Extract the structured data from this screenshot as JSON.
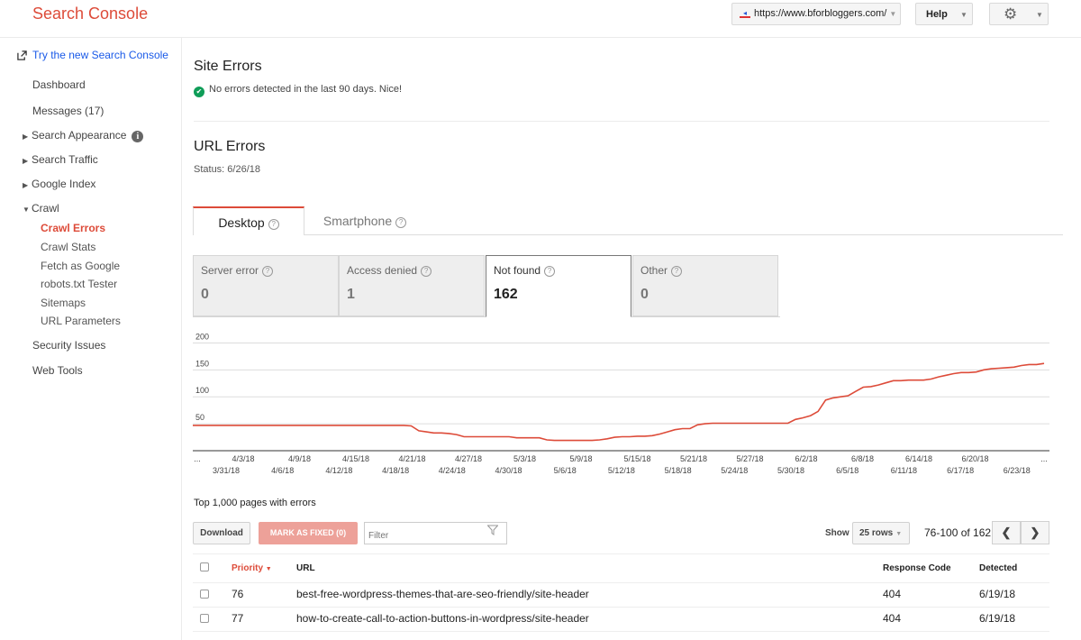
{
  "header": {
    "brand": "Search Console",
    "site": "https://www.bforbloggers.com/",
    "help_label": "Help"
  },
  "sidebar": {
    "try_new": "Try the new Search Console",
    "dashboard": "Dashboard",
    "messages": "Messages (17)",
    "search_appearance": "Search Appearance",
    "search_traffic": "Search Traffic",
    "google_index": "Google Index",
    "crawl": "Crawl",
    "crawl_children": [
      "Crawl Errors",
      "Crawl Stats",
      "Fetch as Google",
      "robots.txt Tester",
      "Sitemaps",
      "URL Parameters"
    ],
    "security_issues": "Security Issues",
    "web_tools": "Web Tools"
  },
  "site_errors": {
    "title": "Site Errors",
    "message": "No errors detected in the last 90 days. Nice!"
  },
  "url_errors": {
    "title": "URL Errors",
    "status": "Status: 6/26/18"
  },
  "tabs": [
    {
      "label": "Desktop",
      "active": true
    },
    {
      "label": "Smartphone",
      "active": false
    }
  ],
  "metrics": [
    {
      "label": "Server error",
      "value": "0"
    },
    {
      "label": "Access denied",
      "value": "1"
    },
    {
      "label": "Not found",
      "value": "162",
      "selected": true
    },
    {
      "label": "Other",
      "value": "0"
    }
  ],
  "chart_data": {
    "type": "line",
    "ylim": [
      0,
      200
    ],
    "yticks": [
      50,
      100,
      150,
      200
    ],
    "x_labels_top": [
      "...",
      "4/3/18",
      "4/9/18",
      "4/15/18",
      "4/21/18",
      "4/27/18",
      "5/3/18",
      "5/9/18",
      "5/15/18",
      "5/21/18",
      "5/27/18",
      "6/2/18",
      "6/8/18",
      "6/14/18",
      "6/20/18",
      "..."
    ],
    "x_labels_bottom": [
      "3/31/18",
      "4/6/18",
      "4/12/18",
      "4/18/18",
      "4/24/18",
      "4/30/18",
      "5/6/18",
      "5/12/18",
      "5/18/18",
      "5/24/18",
      "5/30/18",
      "6/5/18",
      "6/11/18",
      "6/17/18",
      "6/23/18"
    ],
    "series": [
      {
        "color": "#dd4b39",
        "values": [
          47,
          47,
          47,
          47,
          47,
          47,
          47,
          47,
          47,
          47,
          47,
          47,
          47,
          47,
          47,
          47,
          47,
          47,
          47,
          47,
          47,
          47,
          47,
          47,
          47,
          47,
          47,
          47,
          47,
          46,
          37,
          35,
          33,
          33,
          32,
          30,
          26,
          26,
          26,
          26,
          26,
          26,
          26,
          24,
          24,
          24,
          24,
          20,
          19,
          19,
          19,
          19,
          19,
          19,
          20,
          22,
          25,
          26,
          26,
          27,
          27,
          28,
          31,
          35,
          39,
          41,
          41,
          48,
          50,
          51,
          51,
          51,
          51,
          51,
          51,
          51,
          51,
          51,
          51,
          51,
          58,
          61,
          65,
          73,
          94,
          98,
          100,
          102,
          110,
          118,
          119,
          122,
          126,
          130,
          130,
          131,
          131,
          131,
          133,
          137,
          140,
          143,
          145,
          145,
          146,
          150,
          152,
          153,
          154,
          155,
          158,
          160,
          160,
          162
        ]
      }
    ]
  },
  "table": {
    "caption": "Top 1,000 pages with errors",
    "download_label": "Download",
    "mark_fixed_label": "MARK AS FIXED (0)",
    "filter_placeholder": "Filter",
    "show_label": "Show",
    "rows_per_page": "25 rows",
    "pager": "76-100 of 162",
    "columns": {
      "priority": "Priority",
      "url": "URL",
      "response": "Response Code",
      "detected": "Detected"
    },
    "rows": [
      {
        "priority": "76",
        "url": "best-free-wordpress-themes-that-are-seo-friendly/site-header",
        "response": "404",
        "detected": "6/19/18"
      },
      {
        "priority": "77",
        "url": "how-to-create-call-to-action-buttons-in-wordpress/site-header",
        "response": "404",
        "detected": "6/19/18"
      }
    ]
  }
}
